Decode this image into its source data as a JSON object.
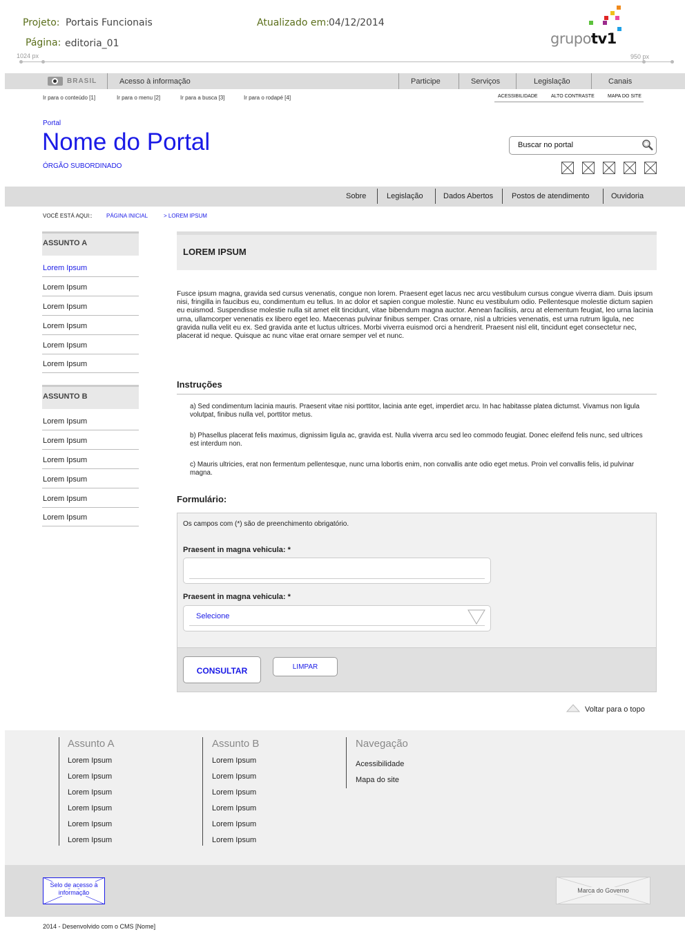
{
  "project": {
    "project_label": "Projeto:",
    "project_value": "Portais Funcionais",
    "updated_label": "Atualizado em:",
    "updated_value": "04/12/2014",
    "page_label": "Página:",
    "page_value": "editoria_01",
    "ruler_left": "1024 px",
    "ruler_right": "950 px",
    "logo_text_light": "grupo",
    "logo_text_bold": "tv1"
  },
  "govbar": {
    "brasil": "BRASIL",
    "access": "Acesso à informação",
    "nav": [
      "Participe",
      "Serviços",
      "Legislação",
      "Canais"
    ],
    "skip_links": [
      "Ir para o conteúdo [1]",
      "Ir para o menu [2]",
      "Ir para a busca [3]",
      "Ir para o rodapé [4]"
    ],
    "acc_links": [
      "ACESSIBILIDADE",
      "ALTO CONTRASTE",
      "MAPA DO SITE"
    ]
  },
  "header": {
    "portal_label": "Portal",
    "title": "Nome do Portal",
    "subtitle": "ÓRGÃO SUBORDINADO",
    "search_placeholder": "Buscar no portal"
  },
  "menu": [
    "Sobre",
    "Legislação",
    "Dados Abertos",
    "Postos de atendimento",
    "Ouvidoria"
  ],
  "breadcrumb": {
    "prefix": "VOCÊ ESTÁ AQUI::",
    "home": "PÁGINA INICIAL",
    "current": "> LOREM IPSUM"
  },
  "sidebar": {
    "a_title": "ASSUNTO A",
    "a_items": [
      "Lorem Ipsum",
      "Lorem Ipsum",
      "Lorem Ipsum",
      "Lorem Ipsum",
      "Lorem Ipsum",
      "Lorem Ipsum"
    ],
    "b_title": "ASSUNTO B",
    "b_items": [
      "Lorem Ipsum",
      "Lorem Ipsum",
      "Lorem Ipsum",
      "Lorem Ipsum",
      "Lorem Ipsum",
      "Lorem Ipsum"
    ]
  },
  "content": {
    "title": "LOREM IPSUM",
    "paragraph": "Fusce ipsum magna, gravida sed cursus venenatis, congue non lorem. Praesent eget lacus nec arcu vestibulum cursus congue viverra diam. Duis ipsum nisi, fringilla in faucibus eu, condimentum eu tellus. In ac dolor et sapien congue molestie. Nunc eu vestibulum odio. Pellentesque molestie dictum sapien eu euismod. Suspendisse molestie nulla sit amet elit tincidunt, vitae bibendum magna auctor. Aenean facilisis, arcu at elementum feugiat, leo urna lacinia urna, ullamcorper venenatis ex libero eget leo. Maecenas pulvinar finibus semper. Cras ornare, nisl a ultricies venenatis, est urna rutrum ligula, nec gravida nulla velit eu ex. Sed gravida ante et luctus ultrices. Morbi viverra euismod orci a hendrerit. Praesent nisl elit, tincidunt eget consectetur nec, placerat id neque. Quisque ac nunc vitae erat ornare semper vel et nunc.",
    "instr_title": "Instruções",
    "instructions": [
      "a) Sed condimentum lacinia mauris. Praesent vitae nisi porttitor, lacinia ante eget, imperdiet arcu. In hac habitasse platea dictumst. Vivamus non ligula volutpat, finibus nulla vel, porttitor metus.",
      "b) Phasellus placerat felis maximus, dignissim ligula ac, gravida est. Nulla viverra arcu sed leo commodo feugiat. Donec eleifend felis nunc, sed ultrices est interdum non.",
      "c) Mauris ultricies, erat non fermentum pellentesque, nunc urna lobortis enim, non convallis ante odio eget metus. Proin vel convallis felis, id pulvinar magna."
    ],
    "form_title": "Formulário:"
  },
  "form": {
    "note": "Os campos com (*) são de preenchimento obrigatório.",
    "field1_label": "Praesent in magna vehicula: *",
    "field1_value": "",
    "field2_label": "Praesent in magna vehicula: *",
    "field2_selected": "Selecione",
    "submit": "CONSULTAR",
    "clear": "LIMPAR"
  },
  "back_to_top": "Voltar para o topo",
  "footer": {
    "col_a_title": "Assunto A",
    "col_a_items": [
      "Lorem Ipsum",
      "Lorem Ipsum",
      "Lorem Ipsum",
      "Lorem Ipsum",
      "Lorem Ipsum",
      "Lorem Ipsum"
    ],
    "col_b_title": "Assunto B",
    "col_b_items": [
      "Lorem Ipsum",
      "Lorem Ipsum",
      "Lorem Ipsum",
      "Lorem Ipsum",
      "Lorem Ipsum",
      "Lorem Ipsum"
    ],
    "col_nav_title": "Navegação",
    "col_nav_items": [
      "Acessibilidade",
      "Mapa do site"
    ],
    "selo_line1": "Selo de acesso à",
    "selo_line2": "informação",
    "marca": "Marca do Governo",
    "copyright": "2014 - Desenvolvido com o CMS [Nome]"
  },
  "icons": {
    "search": "magnifier-icon",
    "social": [
      "social-placeholder-icon",
      "social-placeholder-icon",
      "social-placeholder-icon",
      "social-placeholder-icon",
      "social-placeholder-icon"
    ],
    "select_arrow": "triangle-down-icon",
    "back_to_top": "triangle-up-icon"
  },
  "colors": {
    "link_blue": "#1a1ae6",
    "bar_gray": "#dcdcdc"
  }
}
